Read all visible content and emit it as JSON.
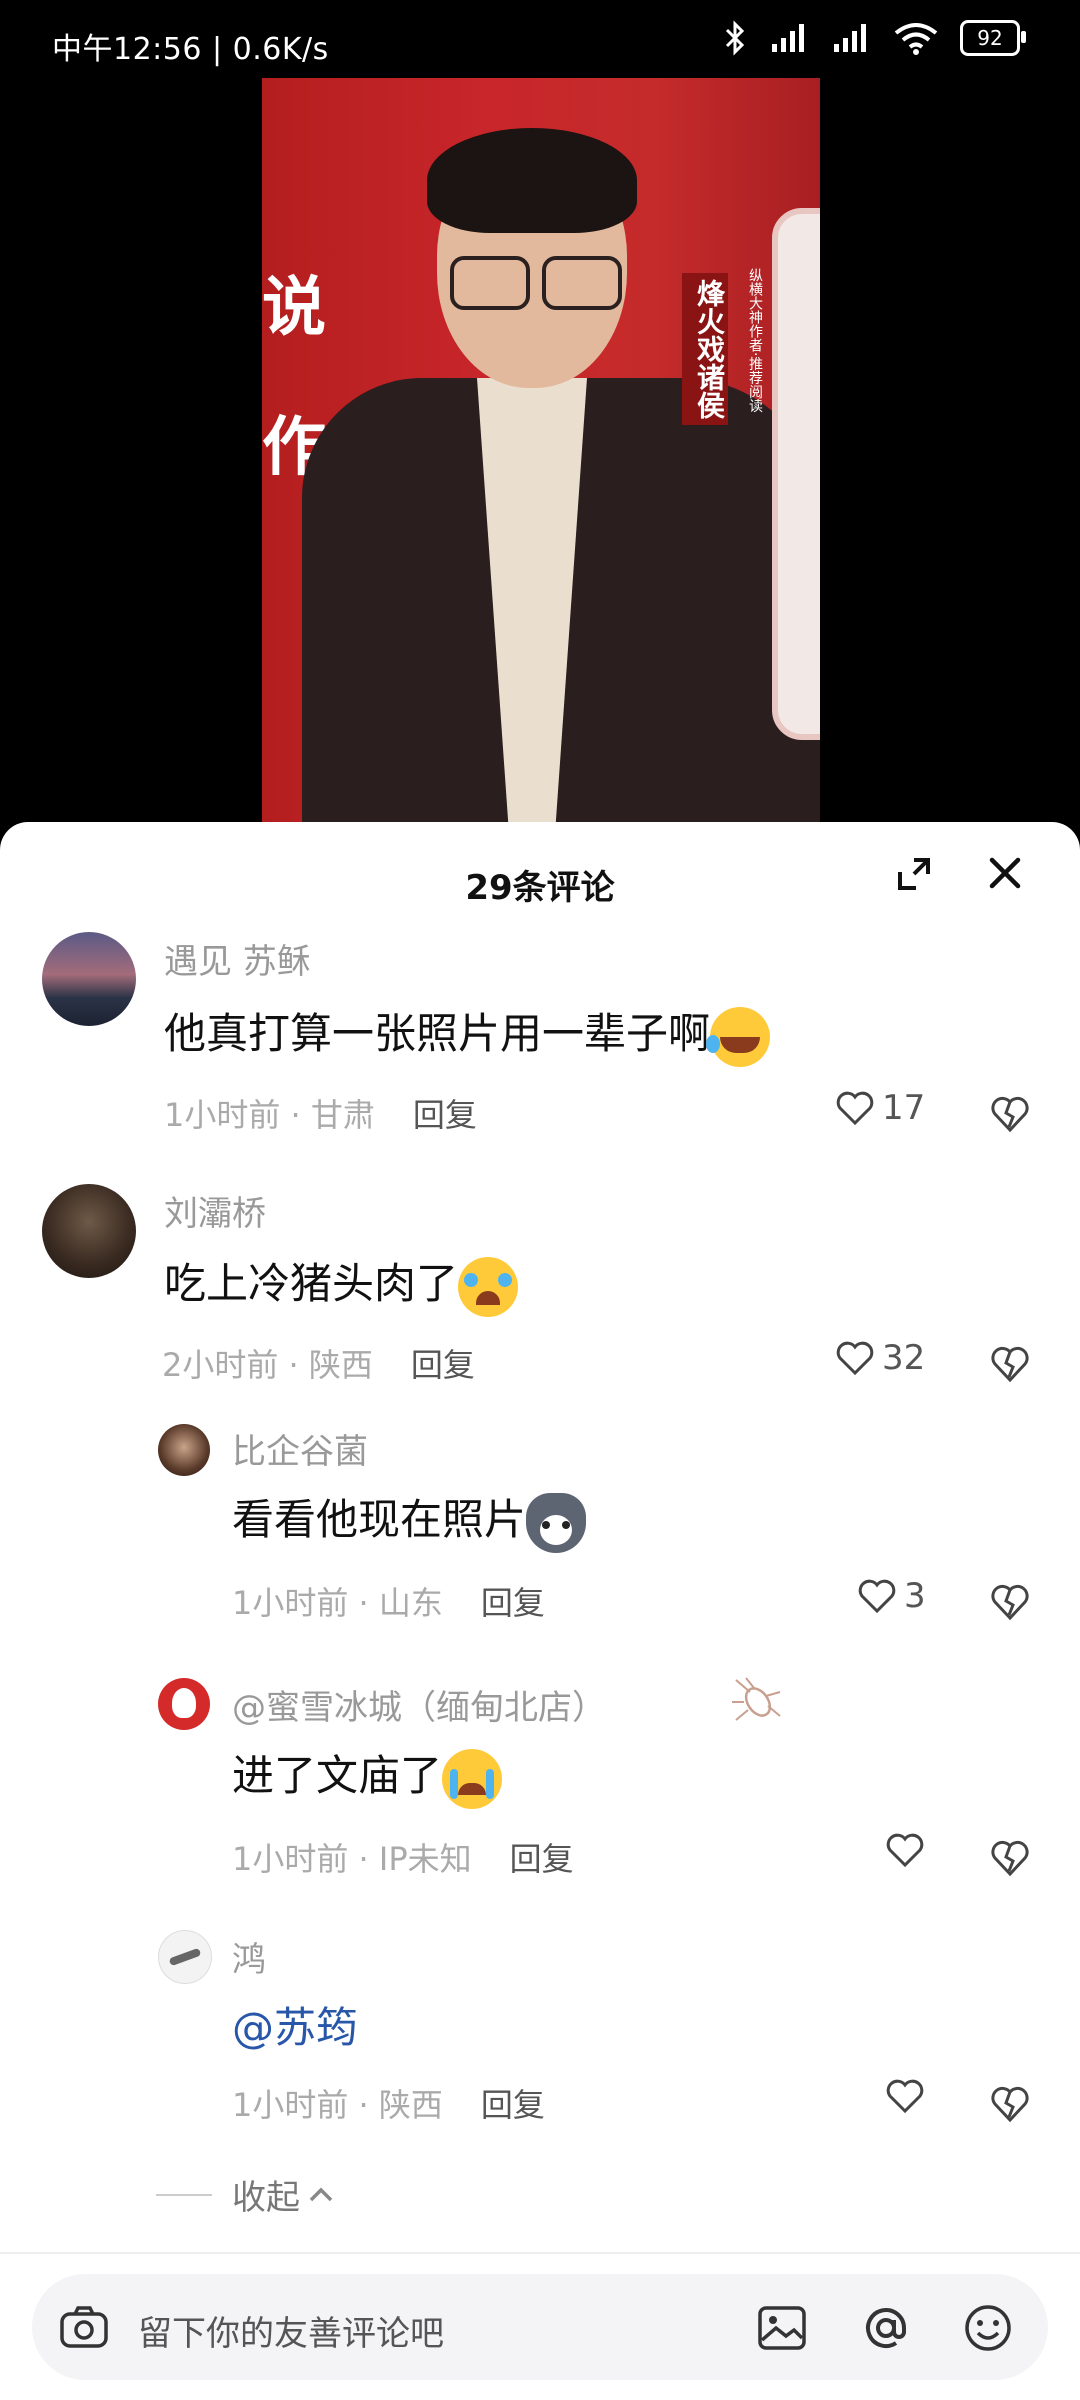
{
  "status_bar": {
    "time_and_speed": "中午12:56 | 0.6K/s",
    "battery": "92"
  },
  "video": {
    "poster_large_chars": "说\n作",
    "poster_title_vertical": "烽火戏诸侯",
    "poster_side_text": "纵横大神作者·推荐阅读"
  },
  "comments_sheet": {
    "title": "29条评论",
    "comments": [
      {
        "username": "遇见  苏稣",
        "text": "他真打算一张照片用一辈子啊",
        "time": "1小时前",
        "location": "甘肃",
        "reply_label": "回复",
        "likes": "17"
      },
      {
        "username": "刘灞桥",
        "text": "吃上冷猪头肉了",
        "time": "2小时前",
        "location": "陕西",
        "reply_label": "回复",
        "likes": "32"
      }
    ],
    "replies": [
      {
        "username": "比企谷菌",
        "text": "看看他现在照片",
        "time": "1小时前",
        "location": "山东",
        "reply_label": "回复",
        "likes": "3"
      },
      {
        "username": "@蜜雪冰城（缅甸北店）",
        "text": "进了文庙了",
        "time": "1小时前",
        "location": "IP未知",
        "reply_label": "回复",
        "likes": ""
      },
      {
        "username": "鸿",
        "text": "@苏筠",
        "time": "1小时前",
        "location": "陕西",
        "reply_label": "回复",
        "likes": ""
      }
    ],
    "collapse_label": "收起"
  },
  "input_bar": {
    "placeholder": "留下你的友善评论吧"
  },
  "colors": {
    "mention": "#2856a8",
    "poster_red": "#c8262a"
  }
}
